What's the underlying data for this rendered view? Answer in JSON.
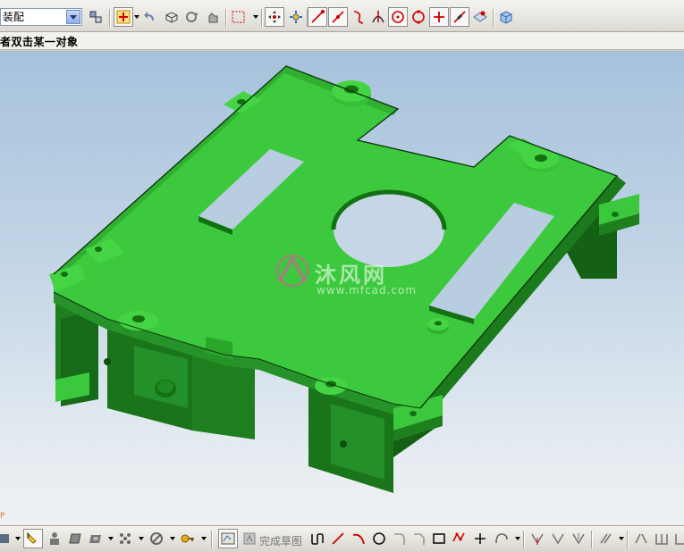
{
  "toolbar": {
    "application_combo_value": "装配",
    "icons": [
      "assembly-navigator-icon",
      "snap-point-icon",
      "undo-icon",
      "fit-view-icon",
      "rotate-icon",
      "pan-icon",
      "select-box-icon",
      "inferred-point-icon",
      "point-constructor-icon",
      "end-point-icon",
      "mid-point-icon",
      "control-point-icon",
      "intersection-icon",
      "arc-center-icon",
      "quadrant-icon",
      "existing-point-icon",
      "point-on-curve-icon",
      "point-on-face-icon",
      "view-cube-icon"
    ]
  },
  "cue_line": {
    "text": "者双击某一对象"
  },
  "viewport": {
    "watermark_text": "沐风网",
    "watermark_url": "www.mfcad.com",
    "wcs_label": "P",
    "model_color": "#3cc83c",
    "model_dark": "#1e7a1e",
    "model_shadow": "#0f4a0f"
  },
  "bottom_toolbar": {
    "finish_sketch_label": "完成草图",
    "icons": [
      "select-arrow-icon",
      "component-icon",
      "profile-icon",
      "face-icon",
      "pattern-icon",
      "no-entry-icon",
      "key-icon",
      "sketch-palette-icon",
      "finish-sketch-flag-icon",
      "profile-line-icon",
      "line-icon",
      "arc-icon",
      "circle-icon",
      "fillet-icon",
      "chamfer-icon",
      "rectangle-icon",
      "polygon-icon",
      "point-icon",
      "studio-spline-icon",
      "trim-icon",
      "extend-icon",
      "make-corner-icon",
      "offset-curve-icon",
      "mirror-curve-icon",
      "constraint-icon"
    ]
  }
}
